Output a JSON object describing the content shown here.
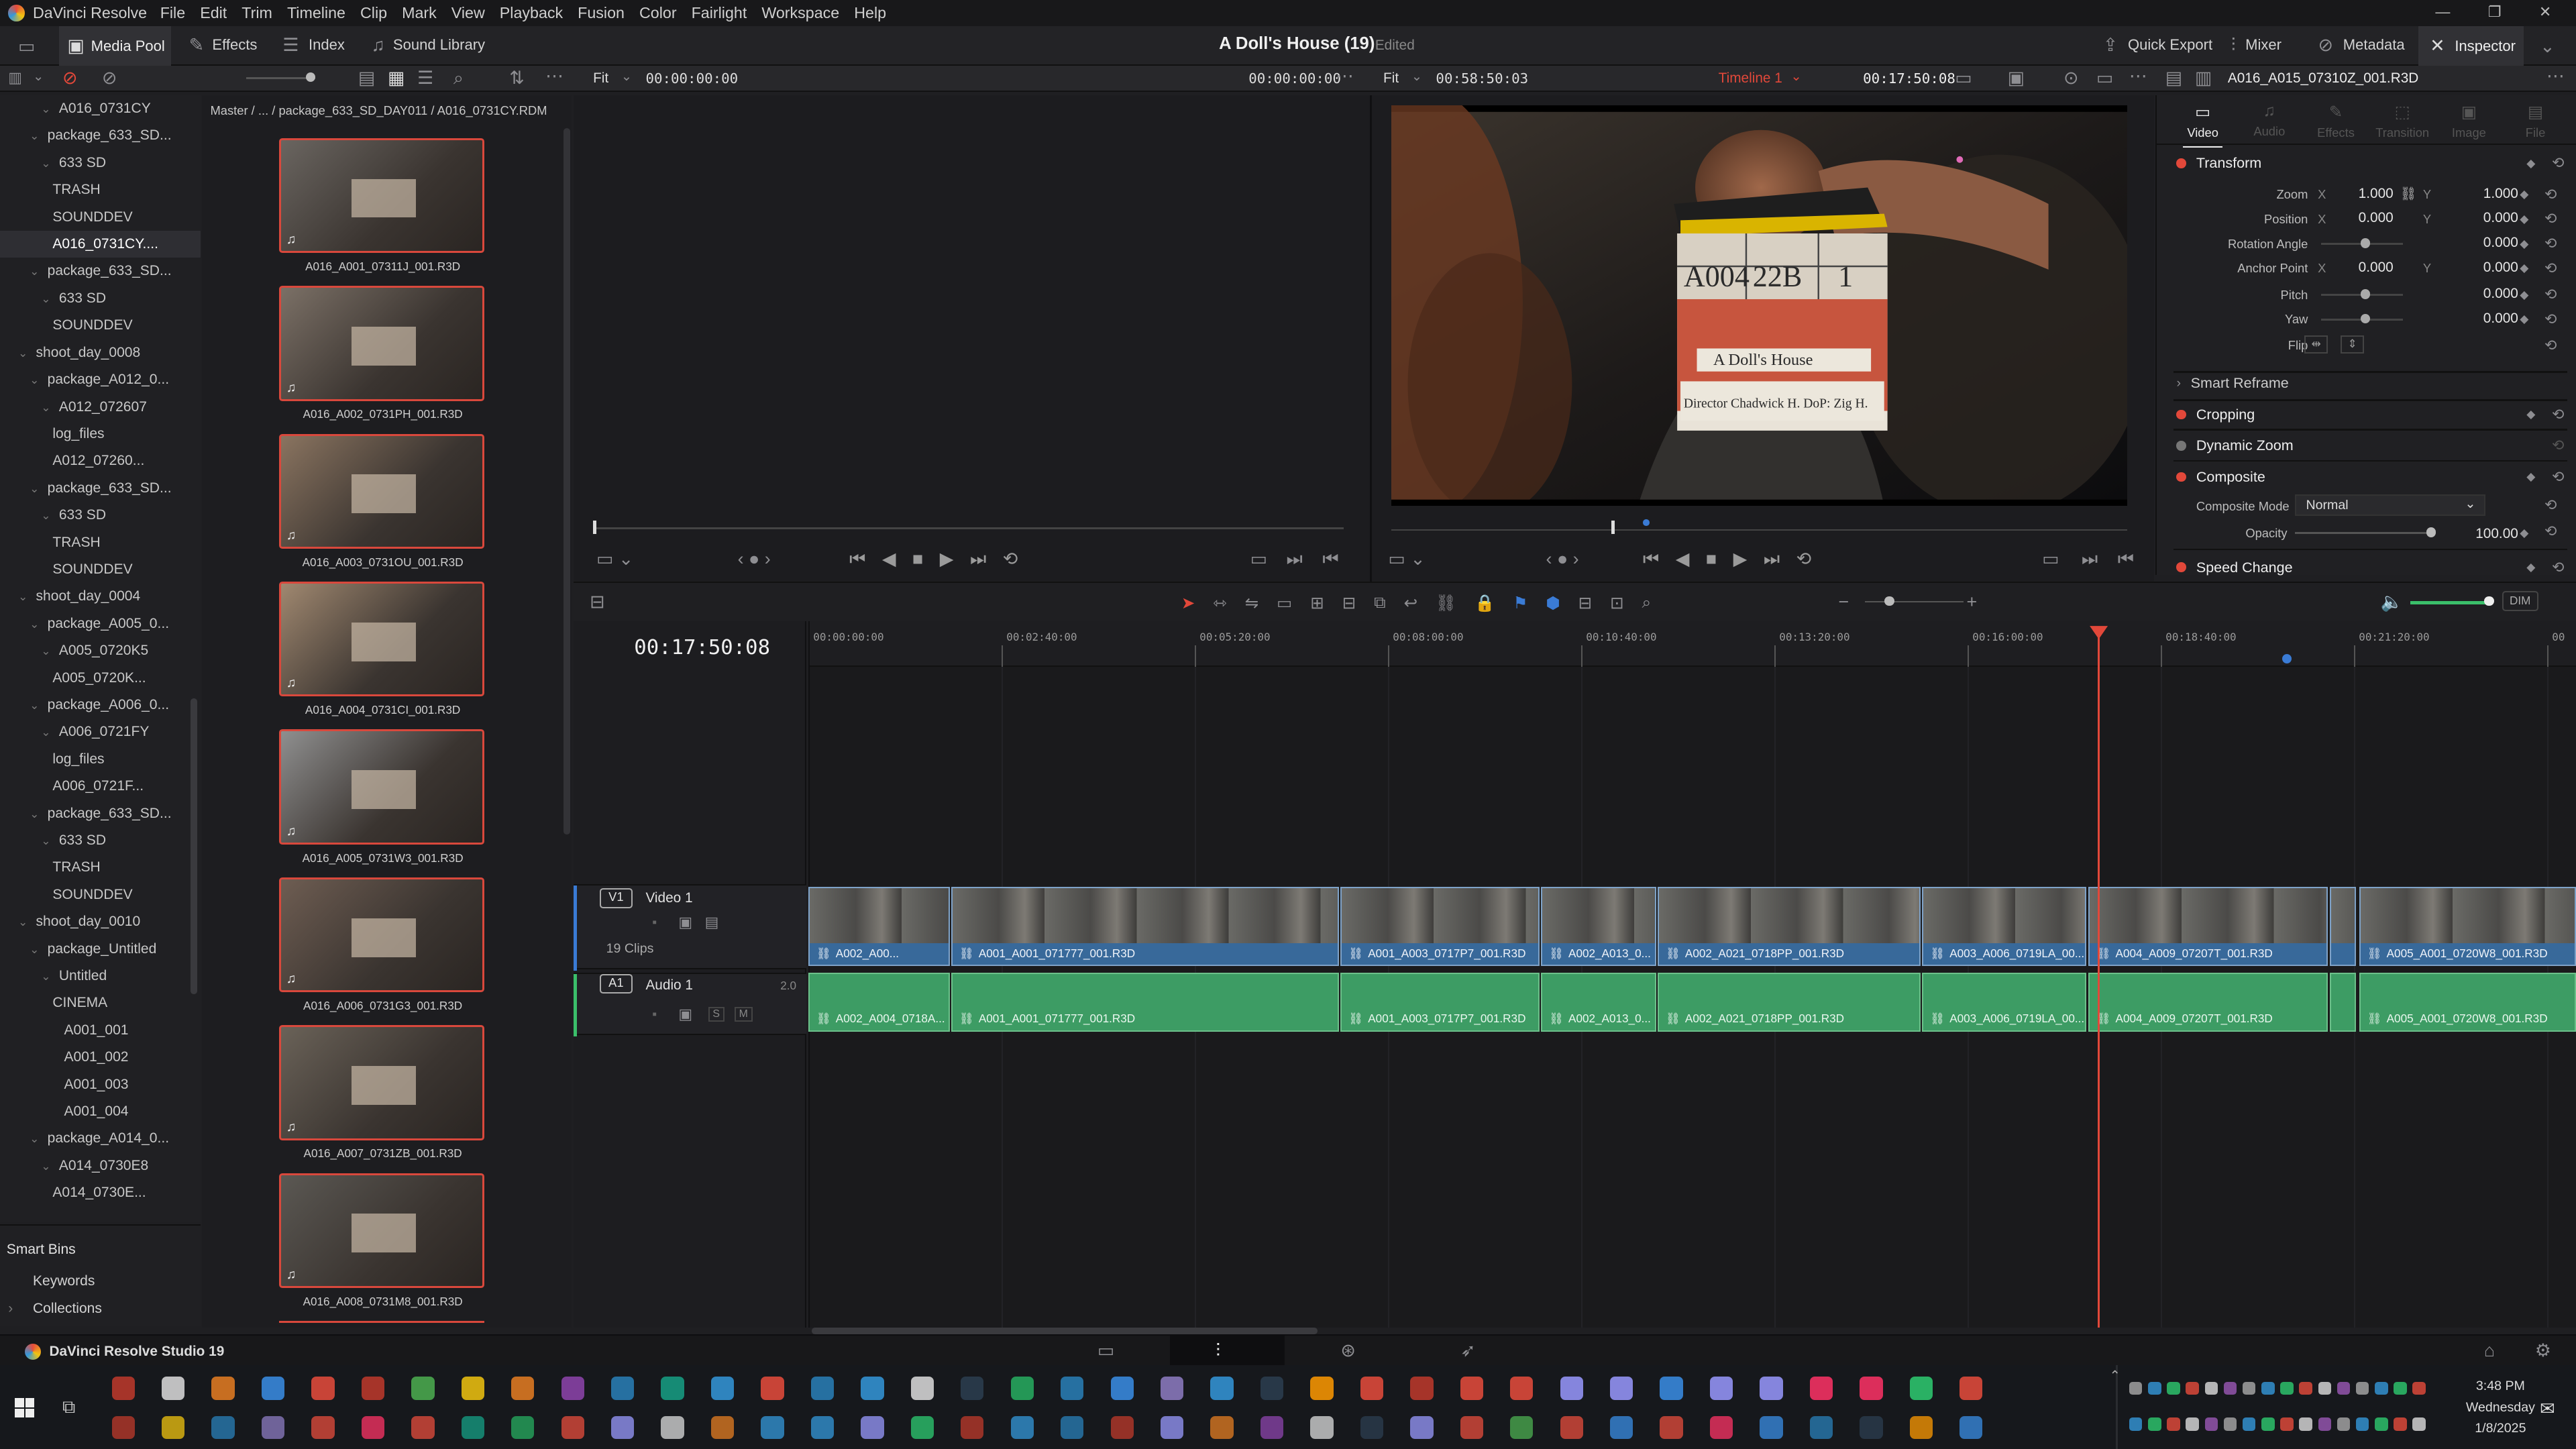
{
  "app": {
    "name": "DaVinci Resolve",
    "menu": [
      "File",
      "Edit",
      "Trim",
      "Timeline",
      "Clip",
      "Mark",
      "View",
      "Playback",
      "Fusion",
      "Color",
      "Fairlight",
      "Workspace",
      "Help"
    ],
    "project_title": "A Doll's House (19)",
    "project_status": "Edited",
    "footer_name": "DaVinci Resolve Studio 19"
  },
  "toolbar": {
    "left": [
      "Media Pool",
      "Effects",
      "Index",
      "Sound Library"
    ],
    "right": [
      "Quick Export",
      "Mixer",
      "Metadata",
      "Inspector"
    ]
  },
  "source_viewer": {
    "fit": "Fit",
    "timecode": "00:00:00:00",
    "timecode2": "00:00:00:00"
  },
  "timeline_viewer": {
    "fit": "Fit",
    "duration": "00:58:50:03",
    "timeline_name": "Timeline 1",
    "timecode": "00:17:50:08"
  },
  "clip_name": "A016_A015_07310Z_001.R3D",
  "breadcrumb": "Master /  ...  / package_633_SD_DAY011 / A016_0731CY.RDM",
  "tree": [
    {
      "label": "A016_0731CY",
      "indent": 3
    },
    {
      "label": "package_633_SD...",
      "indent": 2
    },
    {
      "label": "633 SD",
      "indent": 3
    },
    {
      "label": "TRASH",
      "indent": 4
    },
    {
      "label": "SOUNDDEV",
      "indent": 4
    },
    {
      "label": "A016_0731CY....",
      "indent": 4
    },
    {
      "label": "package_633_SD...",
      "indent": 2
    },
    {
      "label": "633 SD",
      "indent": 3
    },
    {
      "label": "SOUNDDEV",
      "indent": 4
    },
    {
      "label": "shoot_day_0008",
      "indent": 1
    },
    {
      "label": "package_A012_0...",
      "indent": 2
    },
    {
      "label": "A012_072607",
      "indent": 3
    },
    {
      "label": "log_files",
      "indent": 4
    },
    {
      "label": "A012_07260...",
      "indent": 4
    },
    {
      "label": "package_633_SD...",
      "indent": 2
    },
    {
      "label": "633 SD",
      "indent": 3
    },
    {
      "label": "TRASH",
      "indent": 4
    },
    {
      "label": "SOUNDDEV",
      "indent": 4
    },
    {
      "label": "shoot_day_0004",
      "indent": 1
    },
    {
      "label": "package_A005_0...",
      "indent": 2
    },
    {
      "label": "A005_0720K5",
      "indent": 3
    },
    {
      "label": "A005_0720K...",
      "indent": 4
    },
    {
      "label": "package_A006_0...",
      "indent": 2
    },
    {
      "label": "A006_0721FY",
      "indent": 3
    },
    {
      "label": "log_files",
      "indent": 4
    },
    {
      "label": "A006_0721F...",
      "indent": 4
    },
    {
      "label": "package_633_SD...",
      "indent": 2
    },
    {
      "label": "633 SD",
      "indent": 3
    },
    {
      "label": "TRASH",
      "indent": 4
    },
    {
      "label": "SOUNDDEV",
      "indent": 4
    },
    {
      "label": "shoot_day_0010",
      "indent": 1
    },
    {
      "label": "package_Untitled",
      "indent": 2
    },
    {
      "label": "Untitled",
      "indent": 3
    },
    {
      "label": "CINEMA",
      "indent": 4
    },
    {
      "label": "A001_001",
      "indent": 5
    },
    {
      "label": "A001_002",
      "indent": 5
    },
    {
      "label": "A001_003",
      "indent": 5
    },
    {
      "label": "A001_004",
      "indent": 5
    },
    {
      "label": "package_A014_0...",
      "indent": 2
    },
    {
      "label": "A014_0730E8",
      "indent": 3
    },
    {
      "label": "A014_0730E...",
      "indent": 4
    }
  ],
  "smart_bins": {
    "title": "Smart Bins",
    "items": [
      "Keywords",
      "Collections"
    ]
  },
  "media_clips": [
    "A016_A001_07311J_001.R3D",
    "A016_A002_0731PH_001.R3D",
    "A016_A003_0731OU_001.R3D",
    "A016_A004_0731CI_001.R3D",
    "A016_A005_0731W3_001.R3D",
    "A016_A006_0731G3_001.R3D",
    "A016_A007_0731ZB_001.R3D",
    "A016_A008_0731M8_001.R3D"
  ],
  "slate_text": {
    "roll": "A004",
    "scene": "22B",
    "take": "1",
    "production": "A Doll's House",
    "director": "Director Chadwick H. DoP: Zig H."
  },
  "timeline": {
    "current_tc": "00:17:50:08",
    "ruler": [
      "00:00:00:00",
      "00:02:40:00",
      "00:05:20:00",
      "00:08:00:00",
      "00:10:40:00",
      "00:13:20:00",
      "00:16:00:00",
      "00:18:40:00",
      "00:21:20:00",
      "00"
    ],
    "video_track": {
      "badge": "V1",
      "name": "Video 1",
      "count": "19 Clips"
    },
    "audio_track": {
      "badge": "A1",
      "name": "Audio 1",
      "gain": "2.0"
    },
    "video_clips": [
      "A002_A00...",
      "A001_A001_071777_001.R3D",
      "A001_A003_0717P7_001.R3D",
      "A002_A013_0...",
      "A002_A021_0718PP_001.R3D",
      "A003_A006_0719LA_00...",
      "A004_A009_07207T_001.R3D",
      "",
      "A005_A001_0720W8_001.R3D"
    ],
    "audio_clips": [
      "A002_A004_0718A...",
      "A001_A001_071777_001.R3D",
      "A001_A003_0717P7_001.R3D",
      "A002_A013_0...",
      "A002_A021_0718PP_001.R3D",
      "A003_A006_0719LA_00...",
      "A004_A009_07207T_001.R3D",
      "",
      "A005_A001_0720W8_001.R3D"
    ]
  },
  "inspector": {
    "tabs": [
      "Video",
      "Audio",
      "Effects",
      "Transition",
      "Image",
      "File"
    ],
    "transform": {
      "title": "Transform",
      "zoom_label": "Zoom",
      "zoom_x": "1.000",
      "zoom_y": "1.000",
      "position_label": "Position",
      "pos_x": "0.000",
      "pos_y": "0.000",
      "rotation_label": "Rotation Angle",
      "rotation": "0.000",
      "anchor_label": "Anchor Point",
      "anchor_x": "0.000",
      "anchor_y": "0.000",
      "pitch_label": "Pitch",
      "pitch": "0.000",
      "yaw_label": "Yaw",
      "yaw": "0.000",
      "flip_label": "Flip",
      "x": "X",
      "y": "Y"
    },
    "smart_reframe": "Smart Reframe",
    "cropping": "Cropping",
    "dynamic_zoom": "Dynamic Zoom",
    "composite": {
      "title": "Composite",
      "mode_label": "Composite Mode",
      "mode": "Normal",
      "opacity_label": "Opacity",
      "opacity": "100.00"
    },
    "speed_change": "Speed Change"
  },
  "audio": {
    "dim": "DIM"
  },
  "clock": {
    "time": "3:48 PM",
    "day": "Wednesday",
    "date": "1/8/2025"
  },
  "colors": {
    "accent": "#e2483a",
    "video_clip": "#3d6f9e",
    "audio_clip": "#3d9c64",
    "playhead": "#e2483a"
  }
}
